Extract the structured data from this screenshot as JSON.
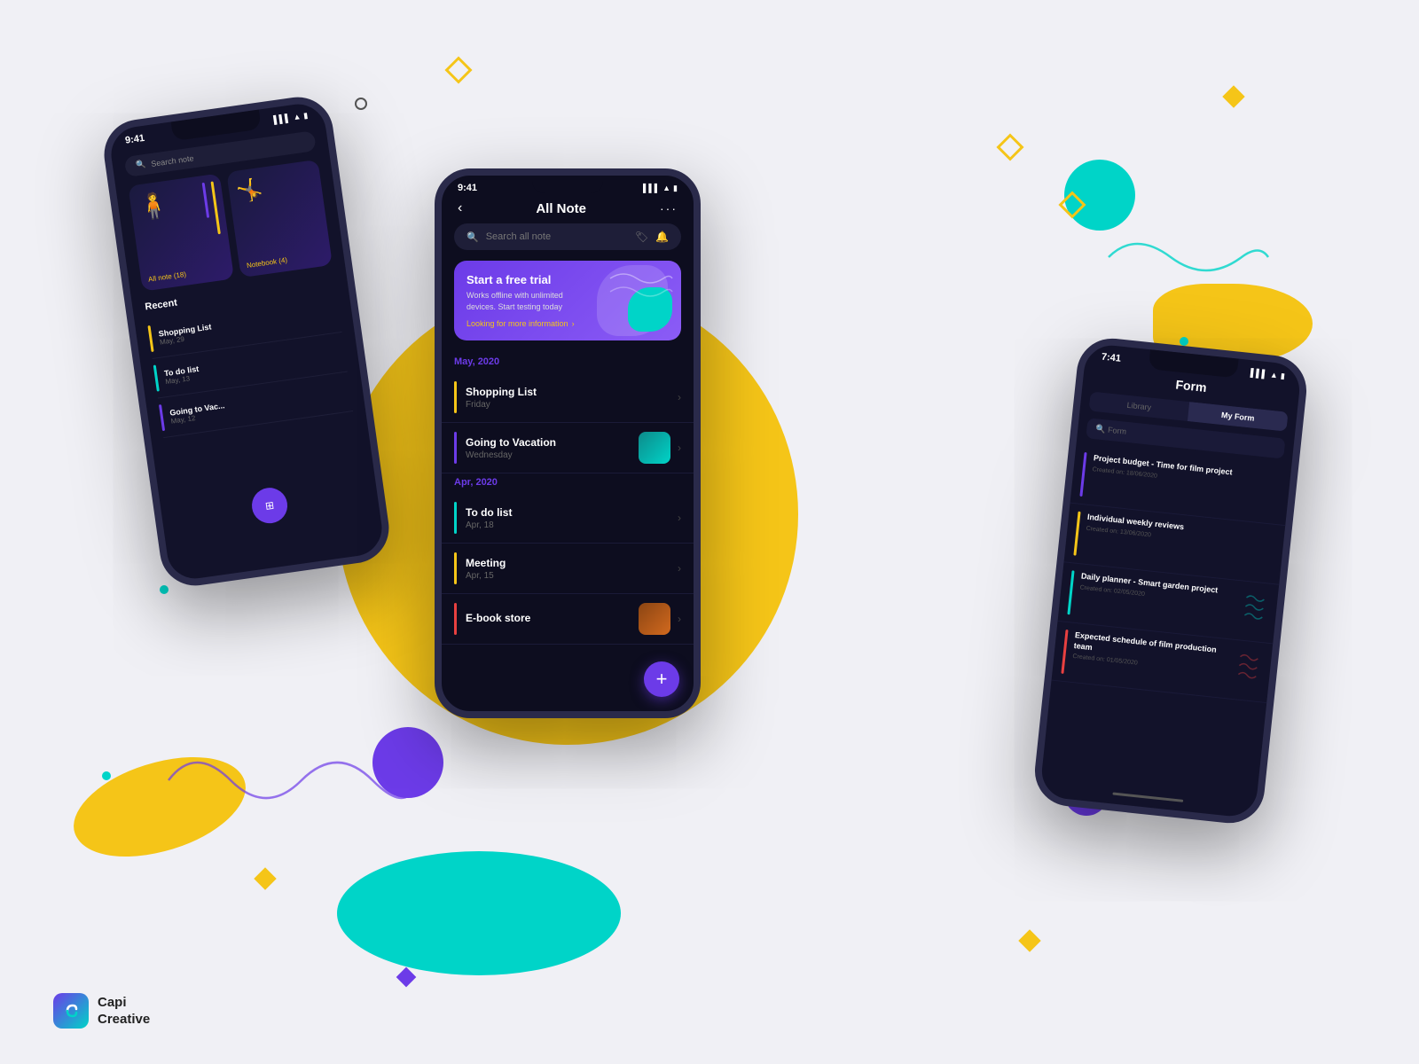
{
  "app": {
    "name": "Capi Creative"
  },
  "decorations": {
    "yellow_circle": true,
    "teal_blob": true
  },
  "phone_left": {
    "status_time": "9:41",
    "search_placeholder": "Search note",
    "notebook_label": "Notebook",
    "notebook_count": "(4)",
    "all_note_label": "All note",
    "all_note_count": "(18)",
    "recent_title": "Recent",
    "recent_items": [
      {
        "name": "Shopping List",
        "date": "May, 29",
        "color": "#f5c518"
      },
      {
        "name": "To do list",
        "date": "May, 13",
        "color": "#00d4c8"
      },
      {
        "name": "Going to Vac...",
        "date": "May, 12",
        "color": "#6c3be8"
      }
    ]
  },
  "phone_center": {
    "status_time": "9:41",
    "title": "All Note",
    "search_placeholder": "Search all note",
    "promo": {
      "title": "Start a free trial",
      "desc": "Works offline with unlimited devices. Start testing today",
      "link": "Looking for more information"
    },
    "may_section": "May, 2020",
    "apr_section": "Apr, 2020",
    "notes": [
      {
        "title": "Shopping List",
        "sub": "Friday",
        "color": "#f5c518",
        "has_thumb": false
      },
      {
        "title": "Going to Vacation",
        "sub": "Wednesday",
        "color": "#6c3be8",
        "has_thumb": true
      },
      {
        "title": "To do list",
        "sub": "Apr, 18",
        "color": "#00d4c8",
        "has_thumb": false
      },
      {
        "title": "Meeting",
        "sub": "Apr, 15",
        "color": "#f5c518",
        "has_thumb": false
      },
      {
        "title": "E-book store",
        "sub": "",
        "color": "#e84040",
        "has_thumb": true
      }
    ],
    "fab_label": "+"
  },
  "phone_right": {
    "status_time": "7:41",
    "title": "Form",
    "tab_library": "Library",
    "tab_my_form": "My Form",
    "search_placeholder": "Form",
    "forms": [
      {
        "title": "Project budget - Time for film project",
        "date": "Created on: 18/06/2020",
        "color": "#6c3be8"
      },
      {
        "title": "Individual weekly reviews",
        "date": "Created on: 13/06/2020",
        "color": "#f5c518"
      },
      {
        "title": "Daily planner - Smart garden project",
        "date": "Created on: 02/05/2020",
        "color": "#00d4c8"
      },
      {
        "title": "Expected schedule of film production team",
        "date": "Created on: 01/05/2020",
        "color": "#e84040"
      }
    ]
  },
  "logo": {
    "icon": "C",
    "line1": "Capi",
    "line2": "Creative"
  }
}
